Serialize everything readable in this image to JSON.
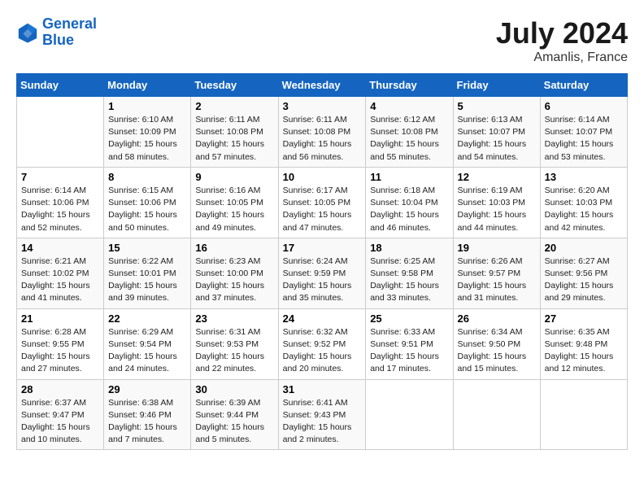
{
  "header": {
    "logo_line1": "General",
    "logo_line2": "Blue",
    "month": "July 2024",
    "location": "Amanlis, France"
  },
  "days_of_week": [
    "Sunday",
    "Monday",
    "Tuesday",
    "Wednesday",
    "Thursday",
    "Friday",
    "Saturday"
  ],
  "weeks": [
    [
      {
        "day": "",
        "info": ""
      },
      {
        "day": "1",
        "info": "Sunrise: 6:10 AM\nSunset: 10:09 PM\nDaylight: 15 hours\nand 58 minutes."
      },
      {
        "day": "2",
        "info": "Sunrise: 6:11 AM\nSunset: 10:08 PM\nDaylight: 15 hours\nand 57 minutes."
      },
      {
        "day": "3",
        "info": "Sunrise: 6:11 AM\nSunset: 10:08 PM\nDaylight: 15 hours\nand 56 minutes."
      },
      {
        "day": "4",
        "info": "Sunrise: 6:12 AM\nSunset: 10:08 PM\nDaylight: 15 hours\nand 55 minutes."
      },
      {
        "day": "5",
        "info": "Sunrise: 6:13 AM\nSunset: 10:07 PM\nDaylight: 15 hours\nand 54 minutes."
      },
      {
        "day": "6",
        "info": "Sunrise: 6:14 AM\nSunset: 10:07 PM\nDaylight: 15 hours\nand 53 minutes."
      }
    ],
    [
      {
        "day": "7",
        "info": "Sunrise: 6:14 AM\nSunset: 10:06 PM\nDaylight: 15 hours\nand 52 minutes."
      },
      {
        "day": "8",
        "info": "Sunrise: 6:15 AM\nSunset: 10:06 PM\nDaylight: 15 hours\nand 50 minutes."
      },
      {
        "day": "9",
        "info": "Sunrise: 6:16 AM\nSunset: 10:05 PM\nDaylight: 15 hours\nand 49 minutes."
      },
      {
        "day": "10",
        "info": "Sunrise: 6:17 AM\nSunset: 10:05 PM\nDaylight: 15 hours\nand 47 minutes."
      },
      {
        "day": "11",
        "info": "Sunrise: 6:18 AM\nSunset: 10:04 PM\nDaylight: 15 hours\nand 46 minutes."
      },
      {
        "day": "12",
        "info": "Sunrise: 6:19 AM\nSunset: 10:03 PM\nDaylight: 15 hours\nand 44 minutes."
      },
      {
        "day": "13",
        "info": "Sunrise: 6:20 AM\nSunset: 10:03 PM\nDaylight: 15 hours\nand 42 minutes."
      }
    ],
    [
      {
        "day": "14",
        "info": "Sunrise: 6:21 AM\nSunset: 10:02 PM\nDaylight: 15 hours\nand 41 minutes."
      },
      {
        "day": "15",
        "info": "Sunrise: 6:22 AM\nSunset: 10:01 PM\nDaylight: 15 hours\nand 39 minutes."
      },
      {
        "day": "16",
        "info": "Sunrise: 6:23 AM\nSunset: 10:00 PM\nDaylight: 15 hours\nand 37 minutes."
      },
      {
        "day": "17",
        "info": "Sunrise: 6:24 AM\nSunset: 9:59 PM\nDaylight: 15 hours\nand 35 minutes."
      },
      {
        "day": "18",
        "info": "Sunrise: 6:25 AM\nSunset: 9:58 PM\nDaylight: 15 hours\nand 33 minutes."
      },
      {
        "day": "19",
        "info": "Sunrise: 6:26 AM\nSunset: 9:57 PM\nDaylight: 15 hours\nand 31 minutes."
      },
      {
        "day": "20",
        "info": "Sunrise: 6:27 AM\nSunset: 9:56 PM\nDaylight: 15 hours\nand 29 minutes."
      }
    ],
    [
      {
        "day": "21",
        "info": "Sunrise: 6:28 AM\nSunset: 9:55 PM\nDaylight: 15 hours\nand 27 minutes."
      },
      {
        "day": "22",
        "info": "Sunrise: 6:29 AM\nSunset: 9:54 PM\nDaylight: 15 hours\nand 24 minutes."
      },
      {
        "day": "23",
        "info": "Sunrise: 6:31 AM\nSunset: 9:53 PM\nDaylight: 15 hours\nand 22 minutes."
      },
      {
        "day": "24",
        "info": "Sunrise: 6:32 AM\nSunset: 9:52 PM\nDaylight: 15 hours\nand 20 minutes."
      },
      {
        "day": "25",
        "info": "Sunrise: 6:33 AM\nSunset: 9:51 PM\nDaylight: 15 hours\nand 17 minutes."
      },
      {
        "day": "26",
        "info": "Sunrise: 6:34 AM\nSunset: 9:50 PM\nDaylight: 15 hours\nand 15 minutes."
      },
      {
        "day": "27",
        "info": "Sunrise: 6:35 AM\nSunset: 9:48 PM\nDaylight: 15 hours\nand 12 minutes."
      }
    ],
    [
      {
        "day": "28",
        "info": "Sunrise: 6:37 AM\nSunset: 9:47 PM\nDaylight: 15 hours\nand 10 minutes."
      },
      {
        "day": "29",
        "info": "Sunrise: 6:38 AM\nSunset: 9:46 PM\nDaylight: 15 hours\nand 7 minutes."
      },
      {
        "day": "30",
        "info": "Sunrise: 6:39 AM\nSunset: 9:44 PM\nDaylight: 15 hours\nand 5 minutes."
      },
      {
        "day": "31",
        "info": "Sunrise: 6:41 AM\nSunset: 9:43 PM\nDaylight: 15 hours\nand 2 minutes."
      },
      {
        "day": "",
        "info": ""
      },
      {
        "day": "",
        "info": ""
      },
      {
        "day": "",
        "info": ""
      }
    ]
  ]
}
